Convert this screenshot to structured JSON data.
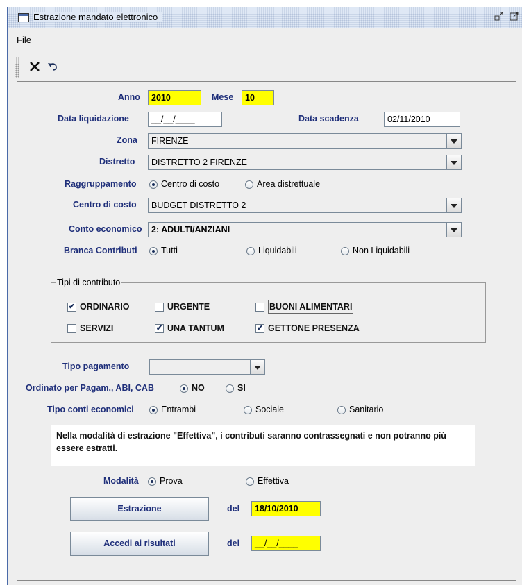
{
  "window": {
    "title": "Estrazione mandato elettronico"
  },
  "menu": {
    "file": "File"
  },
  "toolbar": {
    "cancel_icon": "close-x-icon",
    "undo_icon": "undo-icon"
  },
  "form": {
    "anno_label": "Anno",
    "anno_value": "2010",
    "mese_label": "Mese",
    "mese_value": "10",
    "data_liquidazione_label": "Data liquidazione",
    "data_liquidazione_value": "__/__/____",
    "data_scadenza_label": "Data scadenza",
    "data_scadenza_value": "02/11/2010",
    "zona_label": "Zona",
    "zona_value": "FIRENZE",
    "distretto_label": "Distretto",
    "distretto_value": "DISTRETTO 2 FIRENZE",
    "raggruppamento_label": "Raggruppamento",
    "raggruppamento_options": [
      "Centro di costo",
      "Area distrettuale"
    ],
    "centro_costo_label": "Centro di costo",
    "centro_costo_value": "BUDGET DISTRETTO 2",
    "conto_economico_label": "Conto economico",
    "conto_economico_value": "2: ADULTI/ANZIANI",
    "branca_label": "Branca Contributi",
    "branca_options": [
      "Tutti",
      "Liquidabili",
      "Non Liquidabili"
    ],
    "tipi_title": "Tipi di contributo",
    "tipi": [
      "ORDINARIO",
      "URGENTE",
      "BUONI ALIMENTARI",
      "SERVIZI",
      "UNA TANTUM",
      "GETTONE PRESENZA"
    ],
    "tipi_checked": [
      true,
      false,
      false,
      false,
      true,
      true
    ],
    "tipo_pagamento_label": "Tipo pagamento",
    "tipo_pagamento_value": "",
    "ordinato_label": "Ordinato per Pagam., ABI, CAB",
    "ordinato_options": [
      "NO",
      "SI"
    ],
    "tipo_conti_label": "Tipo conti economici",
    "tipo_conti_options": [
      "Entrambi",
      "Sociale",
      "Sanitario"
    ],
    "note": "Nella modalità di estrazione \"Effettiva\", i contributi saranno contrassegnati e non potranno più essere estratti.",
    "modalita_label": "Modalità",
    "modalita_options": [
      "Prova",
      "Effettiva"
    ],
    "estrazione_button": "Estrazione",
    "del_label": "del",
    "estrazione_date": "18/10/2010",
    "accedi_button": "Accedi ai risultati",
    "accedi_date": "__/__/____"
  },
  "colors": {
    "label": "#1f2f7a",
    "highlight": "#ffff00",
    "window_border": "#4a6aa8"
  }
}
